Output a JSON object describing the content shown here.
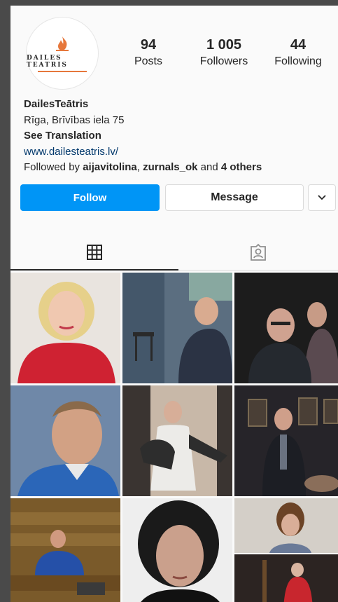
{
  "profile": {
    "logo_text": "DAILES TEATRIS",
    "stats": [
      {
        "value": "94",
        "label": "Posts"
      },
      {
        "value": "1 005",
        "label": "Followers"
      },
      {
        "value": "44",
        "label": "Following"
      }
    ],
    "name": "DailesTeātris",
    "address": "Rīga, Brīvības iela 75",
    "see_translation": "See Translation",
    "website": "www.dailesteatris.lv/",
    "followed_by_prefix": "Followed by ",
    "followed_by_user1": "aijavitolina",
    "followed_by_sep": ", ",
    "followed_by_user2": "zurnals_ok",
    "followed_by_and": " and ",
    "followed_by_others": "4 others"
  },
  "actions": {
    "follow_label": "Follow",
    "message_label": "Message",
    "more_icon": "chevron-down-icon"
  },
  "tabs": [
    {
      "icon": "grid-icon",
      "active": true
    },
    {
      "icon": "tagged-icon",
      "active": false
    }
  ],
  "posts": [
    {
      "subject": "blonde woman in red top smiling"
    },
    {
      "subject": "man seated on stage with stool"
    },
    {
      "subject": "man with glasses and woman behind"
    },
    {
      "subject": "smiling man in blue jacket"
    },
    {
      "subject": "woman in white dress on stage"
    },
    {
      "subject": "man in dark suit with portraits"
    },
    {
      "subject": "man sitting in theater seats"
    },
    {
      "subject": "woman with curly dark hair"
    },
    {
      "subject": "collage of woman and robed man"
    }
  ],
  "colors": {
    "follow_button": "#0095f6",
    "link": "#00376b",
    "text": "#262626",
    "logo_flame": "#e6773b"
  }
}
